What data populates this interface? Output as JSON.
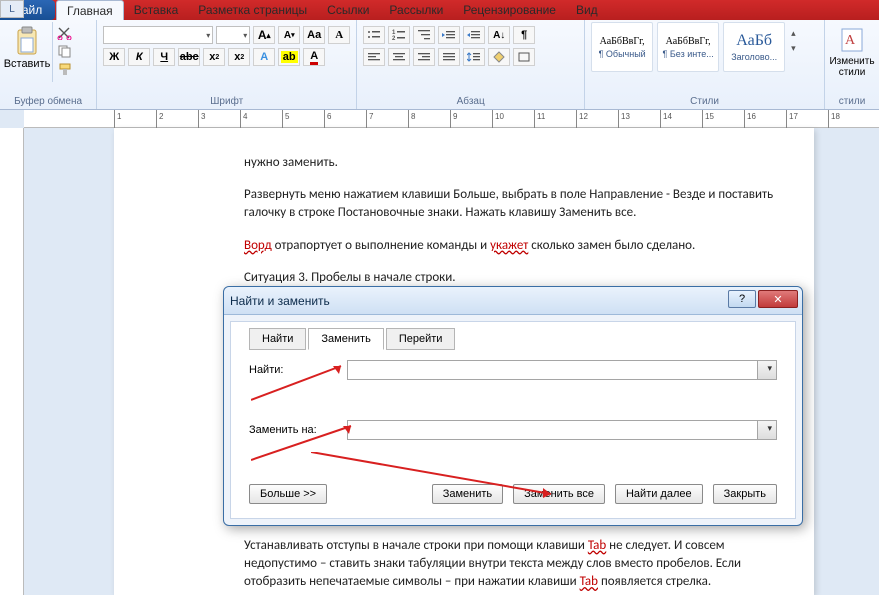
{
  "topbar": {
    "file": "Файл"
  },
  "tabs": [
    "Главная",
    "Вставка",
    "Разметка страницы",
    "Ссылки",
    "Рассылки",
    "Рецензирование",
    "Вид"
  ],
  "ribbon": {
    "clipboard": {
      "title": "Буфер обмена",
      "paste": "Вставить"
    },
    "font": {
      "title": "Шрифт",
      "size": ""
    },
    "paragraph": {
      "title": "Абзац"
    },
    "styles": {
      "title": "Стили",
      "items": [
        {
          "sample": "АаБбВвГг,",
          "name": "¶ Обычный"
        },
        {
          "sample": "АаБбВвГг,",
          "name": "¶ Без инте..."
        },
        {
          "sample": "АаБб",
          "name": "Заголово..."
        }
      ]
    },
    "edit": {
      "title": "стили",
      "change": "Изменить стили"
    }
  },
  "doc": {
    "p1": "нужно заменить.",
    "p2a": "Развернуть меню нажатием клавиши ",
    "p2b": "Больше, выбрать в поле Направление - Везде и поставить галочку в строке Постановочные знаки. Нажать клавишу Заменить все.",
    "p3a": "Ворд",
    "p3b": " отрапортует о выполнение команды и ",
    "p3c": "укажет",
    "p3d": " сколько замен было сделано.",
    "p4": "Ситуация 3. Пробелы в начале строки.",
    "p5a": "Устанавливать отступы в начале строки при помощи клавиши ",
    "p5b": "Tab",
    "p5c": " не следует. И совсем недопустимо – ставить знаки табуляции внутри текста между слов вместо пробелов. Если отобразить непечатаемые символы – при нажатии клавиши ",
    "p5d": "Tab",
    "p5e": " появляется стрелка."
  },
  "ruler_corner": "L",
  "dialog": {
    "title": "Найти и заменить",
    "tabs": [
      "Найти",
      "Заменить",
      "Перейти"
    ],
    "find_label": "Найти:",
    "replace_label": "Заменить на:",
    "find_value": "",
    "replace_value": "",
    "more": "Больше >>",
    "replace": "Заменить",
    "replace_all": "Заменить все",
    "find_next": "Найти далее",
    "close": "Закрыть",
    "help": "?",
    "x": "✕"
  }
}
